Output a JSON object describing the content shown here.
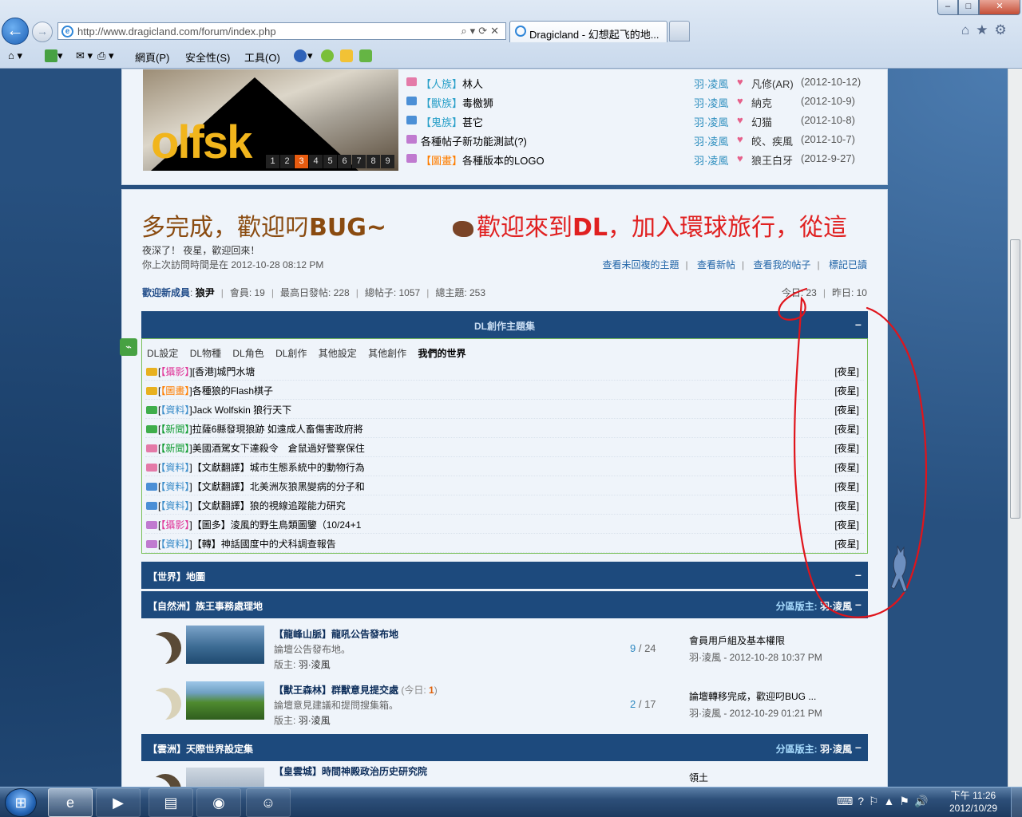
{
  "browser": {
    "url": "http://www.dragicland.com/forum/index.php",
    "tab_title": "Dragicland - 幻想起飞的地...",
    "menu": [
      "網頁(P)",
      "安全性(S)",
      "工具(O)"
    ],
    "win_min": "–",
    "win_max": "□",
    "win_close": "✕"
  },
  "banner": {
    "logo_text": "olfsk",
    "slide_numbers": [
      "1",
      "2",
      "3",
      "4",
      "5",
      "6",
      "7",
      "8",
      "9"
    ],
    "active_slide": "3"
  },
  "recent_threads": [
    {
      "tag": "【人族】",
      "title": "林人",
      "author": "羽·凌風",
      "last_user": "凡修(AR)",
      "date": "(2012-10-12)",
      "icon_color": "#e47aa8",
      "tag_color": "#2aa0c9"
    },
    {
      "tag": "【獸族】",
      "title": "毒檄狮",
      "author": "羽·凌風",
      "last_user": "納克",
      "date": "(2012-10-9)",
      "icon_color": "#4b8fd6",
      "tag_color": "#2aa0c9"
    },
    {
      "tag": "【鬼族】",
      "title": "甚它",
      "author": "羽·凌風",
      "last_user": "幻猫",
      "date": "(2012-10-8)",
      "icon_color": "#4b8fd6",
      "tag_color": "#2aa0c9"
    },
    {
      "tag": "",
      "title": "各種帖子新功能測試(?)",
      "author": "羽·凌風",
      "last_user": "皎、疾風",
      "date": "(2012-10-7)",
      "icon_color": "#c07ad0",
      "tag_color": "#2aa0c9"
    },
    {
      "tag": "【圖畫】",
      "title": "各種版本的LOGO",
      "author": "羽·凌風",
      "last_user": "狼王白牙",
      "date": "(2012-9-27)",
      "icon_color": "#c07ad0",
      "tag_color": "#ff7e00"
    }
  ],
  "main": {
    "marquee_left": "多完成，歡迎叼",
    "marquee_left_bold": "BUG~",
    "marquee_right_pre": "歡迎來到",
    "marquee_right_bold": "DL",
    "marquee_right_post": "，加入環球旅行，從這",
    "greeting": "夜深了！ 夜星，歡迎回來！",
    "last_visit": "你上次訪問時間是在 2012-10-28 08:12 PM",
    "quick_links": [
      "查看未回複的主題",
      "查看新帖",
      "查看我的帖子",
      "標記已讀"
    ],
    "stats": {
      "newest_label": "歡迎新成員",
      "newest_name": "狼尹",
      "members": "會員: 19",
      "max_daily": "最高日發帖: 228",
      "posts": "總帖子: 1057",
      "threads": "總主題: 253",
      "today": "今日: 23",
      "yesterday": "昨日: 10"
    }
  },
  "dl_section": {
    "title": "DL創作主題集",
    "collapse": "–",
    "tabs": [
      "DL設定",
      "DL物種",
      "DL角色",
      "DL創作",
      "其他設定",
      "其他創作"
    ],
    "active_tab": "我們的世界",
    "rows": [
      {
        "pre": "[",
        "tag": "【攝影】",
        "post": "][香港]城門水塘",
        "author": "[夜星]",
        "tag_class": "t-pink",
        "icon_color": "#e8b11f"
      },
      {
        "pre": "[",
        "tag": "【圖畫】",
        "post": "]各種狼的Flash棋子",
        "author": "[夜星]",
        "tag_class": "t-orange",
        "icon_color": "#e8b11f"
      },
      {
        "pre": "[",
        "tag": "【資料】",
        "post": "]Jack Wolfskin 狼行天下",
        "author": "[夜星]",
        "tag_class": "t-blue",
        "icon_color": "#3fae4b"
      },
      {
        "pre": "[",
        "tag": "【新聞】",
        "post": "]拉薩6縣發現狼跡 如遠成人畜傷害政府將",
        "author": "[夜星]",
        "tag_class": "t-green",
        "icon_color": "#3fae4b"
      },
      {
        "pre": "[",
        "tag": "【新聞】",
        "post": "]美國酒駕女下達殺令　倉鼠過好警察保住",
        "author": "[夜星]",
        "tag_class": "t-green",
        "icon_color": "#e47aa8"
      },
      {
        "pre": "[",
        "tag": "【資料】",
        "post": "]【文獻翻譯】城市生態系統中的動物行為",
        "author": "[夜星]",
        "tag_class": "t-blue",
        "icon_color": "#e47aa8"
      },
      {
        "pre": "[",
        "tag": "【資料】",
        "post": "]【文獻翻譯】北美洲灰狼黑變病的分子和",
        "author": "[夜星]",
        "tag_class": "t-blue",
        "icon_color": "#4b8fd6"
      },
      {
        "pre": "[",
        "tag": "【資料】",
        "post": "]【文獻翻譯】狼的視線追蹤能力研究",
        "author": "[夜星]",
        "tag_class": "t-blue",
        "icon_color": "#4b8fd6"
      },
      {
        "pre": "[",
        "tag": "【攝影】",
        "post": "]【圖多】淩風的野生鳥類圖鑒（10/24+1",
        "author": "[夜星]",
        "tag_class": "t-pink",
        "icon_color": "#c07ad0"
      },
      {
        "pre": "[",
        "tag": "【資料】",
        "post": "]【轉】神話國度中的犬科調查報告",
        "author": "[夜星]",
        "tag_class": "t-blue",
        "icon_color": "#c07ad0"
      }
    ]
  },
  "categories": {
    "world": {
      "title": "【世界】地圖",
      "collapse": "–"
    },
    "nature": {
      "title": "【自然洲】族王事務處理地",
      "mods_label": "分區版主:",
      "mods_name": "羽·淩風",
      "collapse": "–"
    },
    "cloud": {
      "title": "【雲洲】天際世界設定集",
      "mods_label": "分區版主:",
      "mods_name": "羽·淩風",
      "collapse": "–"
    }
  },
  "forums": [
    {
      "name": "【龍峰山脈】龍吼公告發布地",
      "today_label": "",
      "today_num": "",
      "today_close": "",
      "desc": "論壇公告發布地。",
      "mod_label": "版主:",
      "mod_name": "羽·淩風",
      "threads": "9",
      "total": "24",
      "last_title": "會員用戶組及基本權限",
      "last_by": "羽·淩風 - 2012-10-28 10:37 PM"
    },
    {
      "name": "【獸王森林】群獸意見提交處",
      "today_label": " (今日: ",
      "today_num": "1",
      "today_close": ")",
      "desc": "論壇意見建議和提問搜集箱。",
      "mod_label": "版主:",
      "mod_name": "羽·淩風",
      "threads": "2",
      "total": "17",
      "last_title": "論壇轉移完成，歡迎叼BUG ...",
      "last_by": "羽·淩風 - 2012-10-29 01:21 PM"
    },
    {
      "name": "【皇雲城】時間神殿政治历史研究院",
      "today_label": "",
      "today_num": "",
      "today_close": "",
      "desc": "",
      "mod_label": "",
      "mod_name": "",
      "threads": "",
      "total": "",
      "last_title": "領土",
      "last_by": ""
    }
  ],
  "taskbar": {
    "clock_time": "下午 11:26",
    "clock_date": "2012/10/29"
  },
  "colors": {
    "header_blue": "#1d4a7d",
    "panel_bg": "#eff4fa",
    "annotation_red": "#e0141b",
    "link_blue": "#2366a8"
  }
}
